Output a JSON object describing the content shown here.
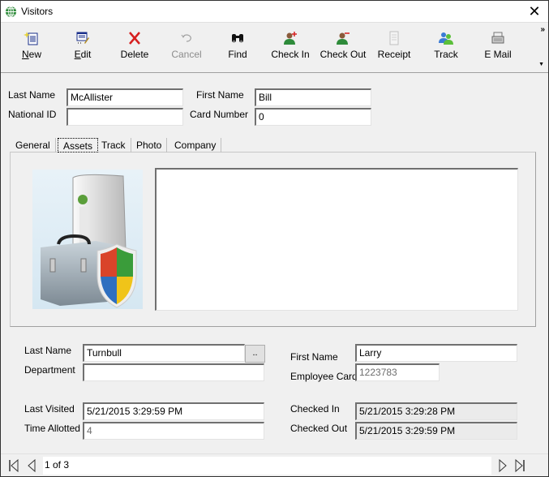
{
  "window": {
    "title": "Visitors",
    "close_label": "✕"
  },
  "toolbar": {
    "buttons": [
      {
        "label": "New",
        "icon": "new-document-icon",
        "underline": "N",
        "rest": "ew",
        "enabled": true
      },
      {
        "label": "Edit",
        "icon": "edit-icon",
        "underline": "E",
        "rest": "dit",
        "enabled": true
      },
      {
        "label": "Delete",
        "icon": "delete-x-icon",
        "enabled": true
      },
      {
        "label": "Cancel",
        "icon": "undo-icon",
        "enabled": false
      },
      {
        "label": "Find",
        "icon": "binoculars-icon",
        "enabled": true
      },
      {
        "label": "Check In",
        "icon": "user-add-icon",
        "enabled": true
      },
      {
        "label": "Check Out",
        "icon": "user-remove-icon",
        "enabled": true
      },
      {
        "label": "Receipt",
        "icon": "receipt-icon",
        "enabled": false
      },
      {
        "label": "Track",
        "icon": "users-icon",
        "enabled": true
      },
      {
        "label": "E Mail",
        "icon": "email-icon",
        "enabled": true
      }
    ],
    "overflow_label": "»",
    "overflow_down": "▼"
  },
  "visitor": {
    "last_name_label": "Last Name",
    "last_name": "McAllister",
    "first_name_label": "First Name",
    "first_name": "Bill",
    "national_id_label": "National ID",
    "national_id": "",
    "card_number_label": "Card Number",
    "card_number": "0"
  },
  "tabs": [
    {
      "label": "General",
      "active": false
    },
    {
      "label": "Assets",
      "active": true
    },
    {
      "label": "Track",
      "active": false
    },
    {
      "label": "Photo",
      "active": false
    },
    {
      "label": "Company",
      "active": false
    }
  ],
  "host": {
    "last_name_label": "Last Name",
    "last_name": "Turnbull",
    "browse_label": "..",
    "first_name_label": "First Name",
    "first_name": "Larry",
    "department_label": "Department",
    "department": "",
    "employee_card_label": "Employee Card",
    "employee_card": "1223783",
    "last_visited_label": "Last Visited",
    "last_visited": "5/21/2015 3:29:59 PM",
    "time_allotted_label": "Time Allotted",
    "time_allotted": "4",
    "checked_in_label": "Checked In",
    "checked_in": "5/21/2015 3:29:28 PM",
    "checked_out_label": "Checked Out",
    "checked_out": "5/21/2015 3:29:59 PM"
  },
  "navigator": {
    "position": "1 of 3"
  }
}
